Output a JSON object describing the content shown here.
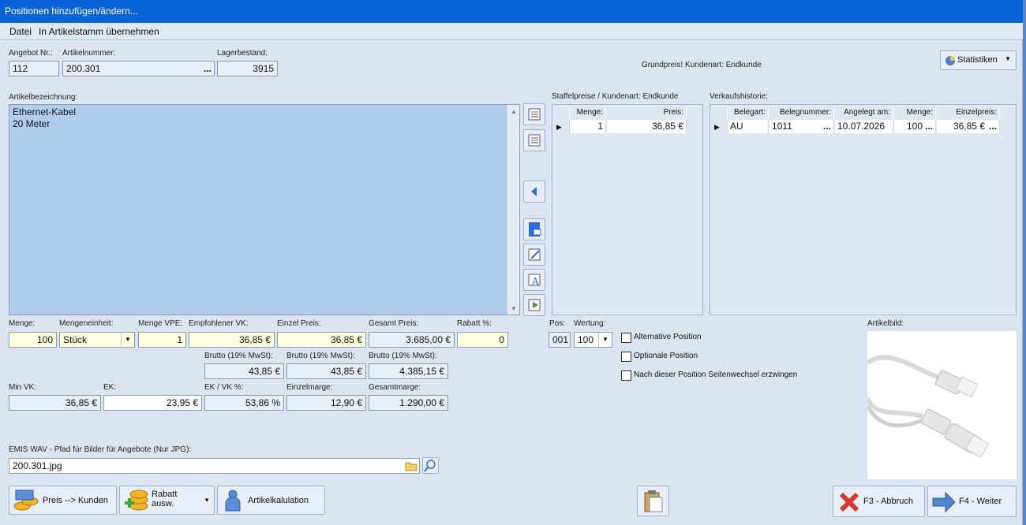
{
  "window": {
    "title": "Positionen hinzufügen/ändern..."
  },
  "menu": {
    "datei": "Datei",
    "uebernehmen": "In Artikelstamm übernehmen"
  },
  "header": {
    "angebot_label": "Angebot Nr.:",
    "angebot_value": "112",
    "artnr_label": "Artikelnummer:",
    "artnr_value": "200.301",
    "lager_label": "Lagerbestand:",
    "lager_value": "3915",
    "grundpreis": "Grundpreis! Kundenart: Endkunde",
    "statistiken": "Statistiken"
  },
  "bezeichnung": {
    "label": "Artikelbezeichnung:",
    "line1": "Ethernet-Kabel",
    "line2": "20 Meter"
  },
  "staffel": {
    "label": "Staffelpreise / Kundenart: Endkunde",
    "col_menge": "Menge:",
    "col_preis": "Preis:",
    "row": {
      "menge": "1",
      "preis": "36,85 €"
    }
  },
  "historie": {
    "label": "Verkaufshistorie:",
    "col_belegart": "Belegart:",
    "col_belegnummer": "Belegnummer:",
    "col_angelegt": "Angelegt am:",
    "col_menge": "Menge:",
    "col_einzelpreis": "Einzelpreis:",
    "row": {
      "belegart": "AU",
      "belegnummer": "1011",
      "angelegt": "10.07.2026",
      "menge": "100",
      "einzelpreis": "36,85 €"
    }
  },
  "fields": {
    "menge_label": "Menge:",
    "menge": "100",
    "einheit_label": "Mengeneinheit:",
    "einheit": "Stück",
    "vpe_label": "Menge VPE:",
    "vpe": "1",
    "empf_label": "Empfohlener VK:",
    "empf": "36,85 €",
    "einzel_label": "Einzel Preis:",
    "einzel": "36,85 €",
    "gesamt_label": "Gesamt Preis:",
    "gesamt": "3.685,00 €",
    "rabatt_label": "Rabatt %:",
    "rabatt": "0",
    "brutto1_label": "Brutto (19% MwSt):",
    "brutto1": "43,85 €",
    "brutto2_label": "Brutto (19% MwSt):",
    "brutto2": "43,85 €",
    "brutto3_label": "Brutto (19% MwSt):",
    "brutto3": "4.385,15 €",
    "minvk_label": "Min VK:",
    "minvk": "36,85 €",
    "ek_label": "EK:",
    "ek": "23,95 €",
    "ekvk_label": "EK / VK %:",
    "ekvk": "53,86 %",
    "einzelmarge_label": "Einzelmarge:",
    "einzelmarge": "12,90 €",
    "gesamtmarge_label": "Gesamtmarge:",
    "gesamtmarge": "1.290,00 €",
    "pos_label": "Pos:",
    "pos": "001",
    "wertung_label": "Wertung:",
    "wertung": "100"
  },
  "options": {
    "alternative": "Alternative Position",
    "optionale": "Optionale Position",
    "seitenwechsel": "Nach dieser Position Seitenwechsel erzwingen"
  },
  "artikelbild": {
    "label": "Artikelbild:"
  },
  "pfad": {
    "label": "EMIS WAV - Pfad für Bilder für Angebote (Nur JPG):",
    "value": "200.301.jpg"
  },
  "buttons": {
    "preis_kunden": "Preis --> Kunden",
    "rabatt_line1": "Rabatt",
    "rabatt_line2": "ausw.",
    "artikelkalkulation": "Artikelkalulation",
    "abbruch": "F3 - Abbruch",
    "weiter": "F4 - Weiter"
  },
  "colors": {
    "titlebar": "#0a64d8",
    "window_bg": "#dbe5f1",
    "textarea_bg": "#b1cced",
    "editable_bg": "#ffffe1"
  }
}
